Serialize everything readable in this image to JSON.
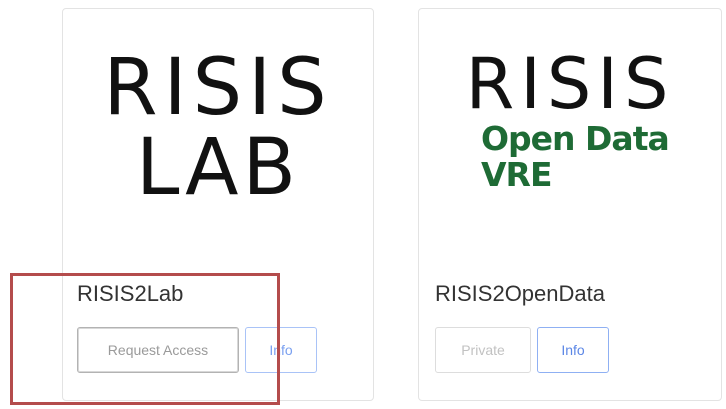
{
  "cards": [
    {
      "logo_lines": [
        "RISIS",
        "LAB"
      ],
      "title": "RISIS2Lab",
      "primary_button": "Request Access",
      "info_button": "Info"
    },
    {
      "logo_lines": [
        "RISIS"
      ],
      "logo_sub_lines": [
        "Open Data",
        "VRE"
      ],
      "title": "RISIS2OpenData",
      "primary_button": "Private",
      "info_button": "Info"
    }
  ],
  "colors": {
    "logo_green": "#1e6b35",
    "highlight": "#b44c4c",
    "info_blue": "#5c87e6"
  }
}
